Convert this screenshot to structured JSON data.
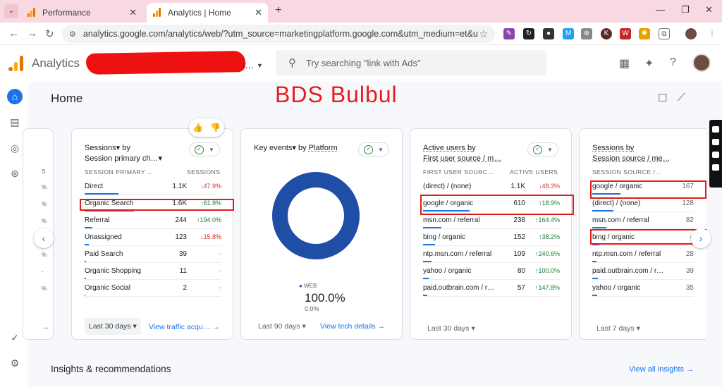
{
  "browser": {
    "tabs": [
      {
        "title": "Performance"
      },
      {
        "title": "Analytics | Home"
      }
    ],
    "new_tab": "+",
    "url": "analytics.google.com/analytics/web/?utm_source=marketingplatform.google.com&utm_medium=et&utm_campaign=..."
  },
  "header": {
    "app_name": "Analytics",
    "account_tail": "r...",
    "search_placeholder": "Try searching \"link with Ads\""
  },
  "main": {
    "page_title": "Home",
    "watermark": "BDS Bulbul",
    "insights_title": "Insights & recommendations",
    "insights_link": "View all insights →"
  },
  "card_left_ghost": {
    "header": "S",
    "cells": [
      "%",
      "%",
      "%",
      "%",
      "%",
      "-",
      "%"
    ]
  },
  "card1": {
    "title_line1": "Sessions▾ by",
    "title_line2": "Session primary ch…▾",
    "col_dim": "SESSION PRIMARY …",
    "col_metric": "SESSIONS",
    "rows": [
      {
        "name": "Direct",
        "value": "1.1K",
        "delta": "↓47.9%",
        "dir": "down",
        "bar": 0.62
      },
      {
        "name": "Organic Search",
        "value": "1.6K",
        "delta": "↑61.9%",
        "dir": "up",
        "bar": 0.9
      },
      {
        "name": "Referral",
        "value": "244",
        "delta": "↑194.0%",
        "dir": "up",
        "bar": 0.14
      },
      {
        "name": "Unassigned",
        "value": "123",
        "delta": "↓15.8%",
        "dir": "down",
        "bar": 0.08
      },
      {
        "name": "Paid Search",
        "value": "39",
        "delta": "-",
        "dir": "na",
        "bar": 0.03
      },
      {
        "name": "Organic Shopping",
        "value": "11",
        "delta": "-",
        "dir": "na",
        "bar": 0.02
      },
      {
        "name": "Organic Social",
        "value": "2",
        "delta": "-",
        "dir": "na",
        "bar": 0.01
      }
    ],
    "date": "Last 30 days ▾",
    "link": "View traffic acqu…  →"
  },
  "card2": {
    "title_a": "Key events▾",
    "title_b": "by",
    "title_c": "Platform",
    "legend": "WEB",
    "big_value": "100.0%",
    "small_value": "0.0%",
    "date": "Last 90 days ▾",
    "link": "View tech details  →"
  },
  "card3": {
    "title_line1": "Active users by",
    "title_line2": "First user source / m…",
    "col_dim": "FIRST USER SOURC…",
    "col_metric": "ACTIVE USERS",
    "rows": [
      {
        "name": "(direct) / (none)",
        "value": "1.1K",
        "delta": "↓48.3%",
        "dir": "down",
        "bar": 0.0
      },
      {
        "name": "google / organic",
        "value": "610",
        "delta": "↑18.9%",
        "dir": "up",
        "bar": 0.55
      },
      {
        "name": "msn.com / referral",
        "value": "238",
        "delta": "↑164.4%",
        "dir": "up",
        "bar": 0.22
      },
      {
        "name": "bing / organic",
        "value": "152",
        "delta": "↑38.2%",
        "dir": "up",
        "bar": 0.14
      },
      {
        "name": "ntp.msn.com / referral",
        "value": "109",
        "delta": "↑240.6%",
        "dir": "up",
        "bar": 0.1
      },
      {
        "name": "yahoo / organic",
        "value": "80",
        "delta": "↑100.0%",
        "dir": "up",
        "bar": 0.07
      },
      {
        "name": "paid.outbrain.com / r…",
        "value": "57",
        "delta": "↑147.8%",
        "dir": "up",
        "bar": 0.05
      }
    ],
    "date": "Last 30 days ▾"
  },
  "card4": {
    "title_line1": "Sessions by",
    "title_line2": "Session source / me…",
    "col_dim": "SESSION SOURCE /…",
    "rows": [
      {
        "name": "google / organic",
        "value": "167",
        "bar": 0.5
      },
      {
        "name": "(direct) / (none)",
        "value": "128",
        "bar": 0.38
      },
      {
        "name": "msn.com / referral",
        "value": "82",
        "bar": 0.25
      },
      {
        "name": "bing / organic",
        "value": "4",
        "bar": 0.12
      },
      {
        "name": "ntp.msn.com / referral",
        "value": "28",
        "bar": 0.08
      },
      {
        "name": "paid.outbrain.com / r…",
        "value": "39",
        "bar": 0.1
      },
      {
        "name": "yahoo / organic",
        "value": "35",
        "bar": 0.09
      }
    ],
    "date": "Last 7 days ▾"
  },
  "colors": {
    "accent": "#1a73e8",
    "highlight": "#e21b1b",
    "donut": "#1e4ea6",
    "up": "#188038",
    "down": "#d93025"
  }
}
